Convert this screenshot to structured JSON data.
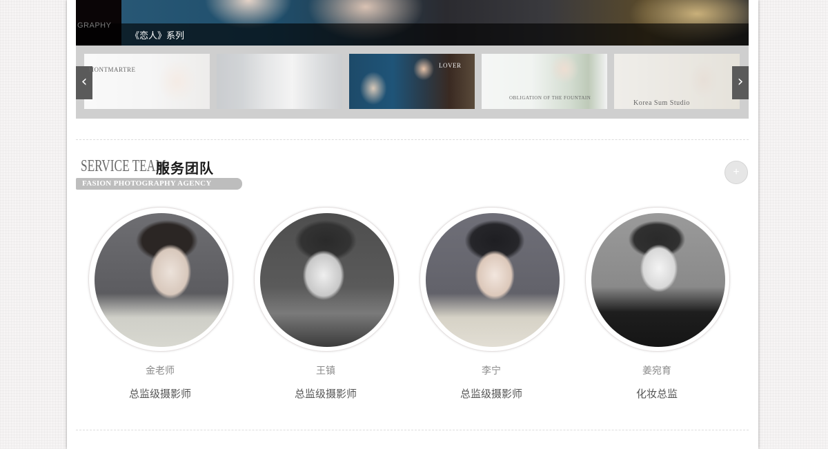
{
  "hero": {
    "side_text": "GRAPHY",
    "caption": "《恋人》系列"
  },
  "gallery": {
    "thumbnails": [
      {
        "label": "MONTMARTRE",
        "active": false
      },
      {
        "label": "",
        "active": false
      },
      {
        "label": "LOVER",
        "active": true
      },
      {
        "label": "OBLIGATION OF THE FOUNTAIN",
        "active": false
      },
      {
        "label": "Korea Sum Studio",
        "active": false
      }
    ],
    "prev_icon": "chevron-left-icon",
    "next_icon": "chevron-right-icon"
  },
  "section": {
    "title_en": "SERVICE TEAM",
    "title_cn": "服务团队",
    "subtitle": "FASION PHOTOGRAPHY AGENCY",
    "more_icon": "plus-icon"
  },
  "team": [
    {
      "name": "金老师",
      "role": "总监级摄影师"
    },
    {
      "name": "王镇",
      "role": "总监级摄影师"
    },
    {
      "name": "李宁",
      "role": "总监级摄影师"
    },
    {
      "name": "姜宛育",
      "role": "化妆总监"
    }
  ],
  "colors": {
    "page_background": "#f6f4f4",
    "content_background": "#ffffff",
    "strip_background": "#cfcfcf",
    "arrow_background": "#5a5a5a",
    "badge_background": "#bdbdbd"
  }
}
